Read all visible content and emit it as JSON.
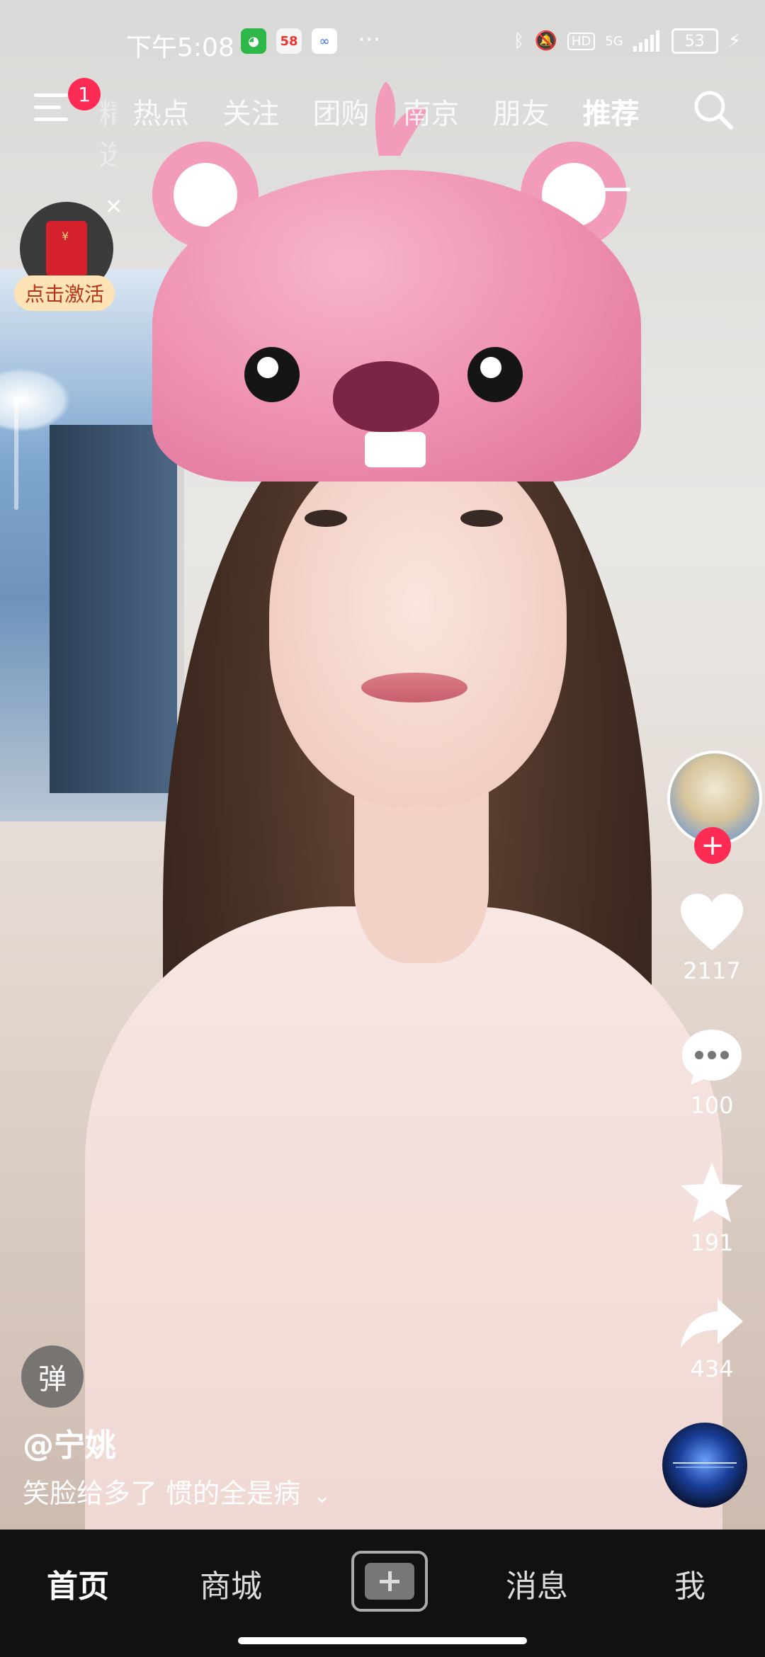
{
  "status_bar": {
    "time": "下午5:08",
    "apps": [
      "wechat-like",
      "58",
      "baidu-like"
    ],
    "dots": "···",
    "network": "5G",
    "battery": "53"
  },
  "top_nav": {
    "badge": "1",
    "cut_tab": "精选",
    "tabs": [
      "热点",
      "关注",
      "团购",
      "南京",
      "朋友",
      "推荐"
    ],
    "active_tab": "推荐"
  },
  "red_packet": {
    "label": "点击激活"
  },
  "rail": {
    "likes": "2117",
    "comments": "100",
    "favorites": "191",
    "shares": "434"
  },
  "video": {
    "danmu": "弹",
    "author": "@宁姚",
    "caption": "笑脸给多了 惯的全是病"
  },
  "bottom_nav": {
    "home": "首页",
    "mall": "商城",
    "messages": "消息",
    "me": "我"
  },
  "colors": {
    "accent": "#fe2c55",
    "bar": "#111111"
  }
}
